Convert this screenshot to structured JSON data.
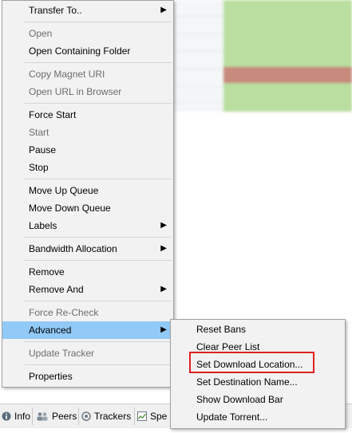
{
  "menu": {
    "items": [
      {
        "label": "Transfer To..",
        "submenu": true,
        "disabled": false
      },
      {
        "label": "Open",
        "disabled": true
      },
      {
        "label": "Open Containing Folder",
        "disabled": false
      },
      {
        "label": "Copy Magnet URI",
        "disabled": true
      },
      {
        "label": "Open URL in Browser",
        "disabled": true
      },
      {
        "label": "Force Start",
        "disabled": false
      },
      {
        "label": "Start",
        "disabled": true
      },
      {
        "label": "Pause",
        "disabled": false
      },
      {
        "label": "Stop",
        "disabled": false
      },
      {
        "label": "Move Up Queue",
        "disabled": false
      },
      {
        "label": "Move Down Queue",
        "disabled": false
      },
      {
        "label": "Labels",
        "submenu": true,
        "disabled": false
      },
      {
        "label": "Bandwidth Allocation",
        "submenu": true,
        "disabled": false
      },
      {
        "label": "Remove",
        "disabled": false
      },
      {
        "label": "Remove And",
        "submenu": true,
        "disabled": false
      },
      {
        "label": "Force Re-Check",
        "disabled": true
      },
      {
        "label": "Advanced",
        "submenu": true,
        "highlighted": true
      },
      {
        "label": "Update Tracker",
        "disabled": true
      },
      {
        "label": "Properties",
        "disabled": false
      }
    ],
    "arrow_glyph": "›"
  },
  "advanced_submenu": {
    "items": [
      {
        "label": "Reset Bans"
      },
      {
        "label": "Clear Peer List"
      },
      {
        "label": "Set Download Location...",
        "outlined": true
      },
      {
        "label": "Set Destination Name..."
      },
      {
        "label": "Show Download Bar"
      },
      {
        "label": "Update Torrent..."
      }
    ]
  },
  "tabs": [
    {
      "label": "Info",
      "icon": "info-icon"
    },
    {
      "label": "Peers",
      "icon": "peers-icon"
    },
    {
      "label": "Trackers",
      "icon": "trackers-icon"
    },
    {
      "label": "Spe",
      "icon": "speed-icon"
    }
  ],
  "colors": {
    "highlight": "#91c9f7",
    "outline": "#e02020",
    "menu_bg": "#f2f2f2"
  }
}
